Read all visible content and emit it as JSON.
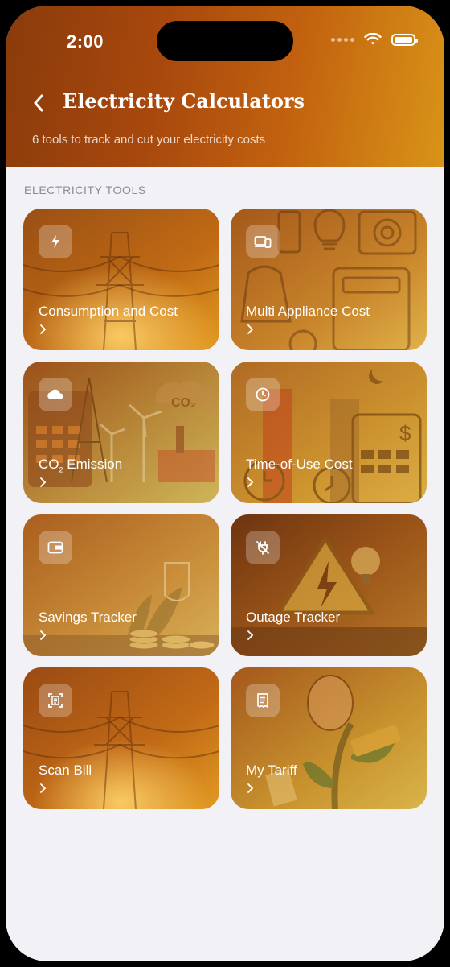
{
  "status": {
    "time": "2:00"
  },
  "header": {
    "title": "Electricity Calculators",
    "subtitle": "6 tools to track and cut your electricity costs"
  },
  "section": {
    "label": "ELECTRICITY TOOLS"
  },
  "tools": [
    {
      "label": "Consumption and Cost",
      "icon": "bolt-icon"
    },
    {
      "label": "Multi Appliance Cost",
      "icon": "devices-icon"
    },
    {
      "label": "CO",
      "subscript": "2",
      "label_rest": " Emission",
      "icon": "cloud-icon"
    },
    {
      "label": "Time-of-Use Cost",
      "icon": "clock-icon"
    },
    {
      "label": "Savings Tracker",
      "icon": "wallet-icon"
    },
    {
      "label": "Outage Tracker",
      "icon": "plug-off-icon"
    },
    {
      "label": "Scan Bill",
      "icon": "scan-icon"
    },
    {
      "label": "My Tariff",
      "icon": "receipt-icon"
    }
  ],
  "colors": {
    "header_start": "#8a3b0b",
    "header_end": "#d99418",
    "background": "#f2f2f6"
  }
}
